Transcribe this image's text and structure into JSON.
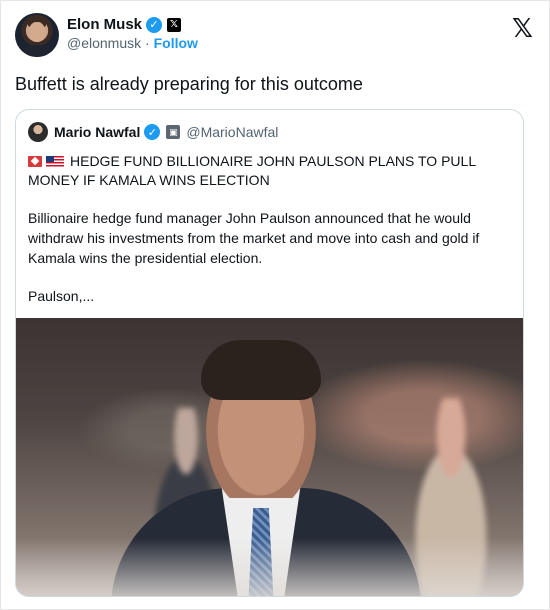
{
  "author": {
    "name": "Elon Musk",
    "handle": "@elonmusk",
    "separator": "·",
    "follow_label": "Follow"
  },
  "tweet": {
    "text": "Buffett is already preparing for this outcome"
  },
  "quote": {
    "name": "Mario Nawfal",
    "handle": "@MarioNawfal",
    "headline": "HEDGE FUND BILLIONAIRE JOHN PAULSON PLANS TO PULL MONEY IF KAMALA WINS ELECTION",
    "body": "Billionaire hedge fund manager John Paulson announced that he would withdraw his investments from the market and move into cash and gold if Kamala wins the presidential election.",
    "more": "Paulson,..."
  },
  "colors": {
    "accent": "#1d9bf0",
    "secondary_text": "#536471",
    "border": "#cfd9de"
  },
  "icons": {
    "verified": "verified-check-icon",
    "brand": "x-logo-icon"
  }
}
